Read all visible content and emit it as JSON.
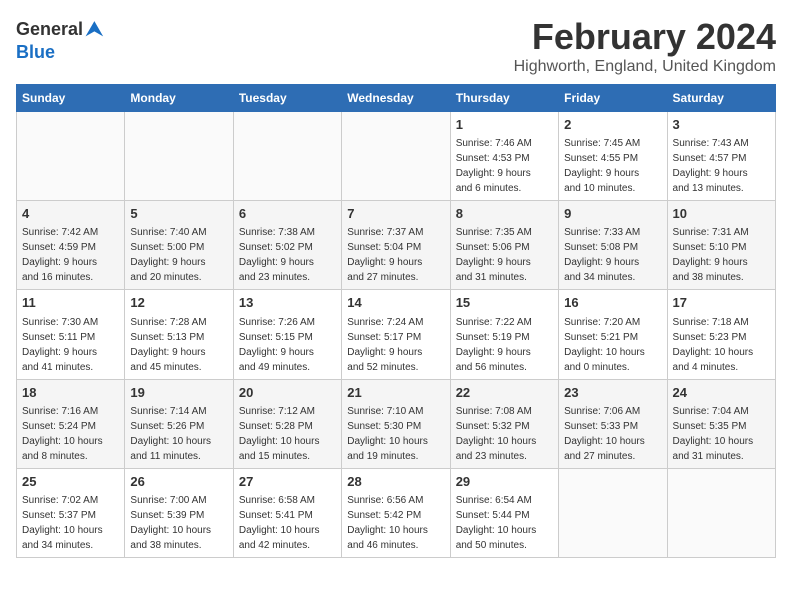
{
  "header": {
    "logo_general": "General",
    "logo_blue": "Blue",
    "title": "February 2024",
    "subtitle": "Highworth, England, United Kingdom"
  },
  "calendar": {
    "columns": [
      "Sunday",
      "Monday",
      "Tuesday",
      "Wednesday",
      "Thursday",
      "Friday",
      "Saturday"
    ],
    "weeks": [
      [
        {
          "day": "",
          "info": ""
        },
        {
          "day": "",
          "info": ""
        },
        {
          "day": "",
          "info": ""
        },
        {
          "day": "",
          "info": ""
        },
        {
          "day": "1",
          "info": "Sunrise: 7:46 AM\nSunset: 4:53 PM\nDaylight: 9 hours\nand 6 minutes."
        },
        {
          "day": "2",
          "info": "Sunrise: 7:45 AM\nSunset: 4:55 PM\nDaylight: 9 hours\nand 10 minutes."
        },
        {
          "day": "3",
          "info": "Sunrise: 7:43 AM\nSunset: 4:57 PM\nDaylight: 9 hours\nand 13 minutes."
        }
      ],
      [
        {
          "day": "4",
          "info": "Sunrise: 7:42 AM\nSunset: 4:59 PM\nDaylight: 9 hours\nand 16 minutes."
        },
        {
          "day": "5",
          "info": "Sunrise: 7:40 AM\nSunset: 5:00 PM\nDaylight: 9 hours\nand 20 minutes."
        },
        {
          "day": "6",
          "info": "Sunrise: 7:38 AM\nSunset: 5:02 PM\nDaylight: 9 hours\nand 23 minutes."
        },
        {
          "day": "7",
          "info": "Sunrise: 7:37 AM\nSunset: 5:04 PM\nDaylight: 9 hours\nand 27 minutes."
        },
        {
          "day": "8",
          "info": "Sunrise: 7:35 AM\nSunset: 5:06 PM\nDaylight: 9 hours\nand 31 minutes."
        },
        {
          "day": "9",
          "info": "Sunrise: 7:33 AM\nSunset: 5:08 PM\nDaylight: 9 hours\nand 34 minutes."
        },
        {
          "day": "10",
          "info": "Sunrise: 7:31 AM\nSunset: 5:10 PM\nDaylight: 9 hours\nand 38 minutes."
        }
      ],
      [
        {
          "day": "11",
          "info": "Sunrise: 7:30 AM\nSunset: 5:11 PM\nDaylight: 9 hours\nand 41 minutes."
        },
        {
          "day": "12",
          "info": "Sunrise: 7:28 AM\nSunset: 5:13 PM\nDaylight: 9 hours\nand 45 minutes."
        },
        {
          "day": "13",
          "info": "Sunrise: 7:26 AM\nSunset: 5:15 PM\nDaylight: 9 hours\nand 49 minutes."
        },
        {
          "day": "14",
          "info": "Sunrise: 7:24 AM\nSunset: 5:17 PM\nDaylight: 9 hours\nand 52 minutes."
        },
        {
          "day": "15",
          "info": "Sunrise: 7:22 AM\nSunset: 5:19 PM\nDaylight: 9 hours\nand 56 minutes."
        },
        {
          "day": "16",
          "info": "Sunrise: 7:20 AM\nSunset: 5:21 PM\nDaylight: 10 hours\nand 0 minutes."
        },
        {
          "day": "17",
          "info": "Sunrise: 7:18 AM\nSunset: 5:23 PM\nDaylight: 10 hours\nand 4 minutes."
        }
      ],
      [
        {
          "day": "18",
          "info": "Sunrise: 7:16 AM\nSunset: 5:24 PM\nDaylight: 10 hours\nand 8 minutes."
        },
        {
          "day": "19",
          "info": "Sunrise: 7:14 AM\nSunset: 5:26 PM\nDaylight: 10 hours\nand 11 minutes."
        },
        {
          "day": "20",
          "info": "Sunrise: 7:12 AM\nSunset: 5:28 PM\nDaylight: 10 hours\nand 15 minutes."
        },
        {
          "day": "21",
          "info": "Sunrise: 7:10 AM\nSunset: 5:30 PM\nDaylight: 10 hours\nand 19 minutes."
        },
        {
          "day": "22",
          "info": "Sunrise: 7:08 AM\nSunset: 5:32 PM\nDaylight: 10 hours\nand 23 minutes."
        },
        {
          "day": "23",
          "info": "Sunrise: 7:06 AM\nSunset: 5:33 PM\nDaylight: 10 hours\nand 27 minutes."
        },
        {
          "day": "24",
          "info": "Sunrise: 7:04 AM\nSunset: 5:35 PM\nDaylight: 10 hours\nand 31 minutes."
        }
      ],
      [
        {
          "day": "25",
          "info": "Sunrise: 7:02 AM\nSunset: 5:37 PM\nDaylight: 10 hours\nand 34 minutes."
        },
        {
          "day": "26",
          "info": "Sunrise: 7:00 AM\nSunset: 5:39 PM\nDaylight: 10 hours\nand 38 minutes."
        },
        {
          "day": "27",
          "info": "Sunrise: 6:58 AM\nSunset: 5:41 PM\nDaylight: 10 hours\nand 42 minutes."
        },
        {
          "day": "28",
          "info": "Sunrise: 6:56 AM\nSunset: 5:42 PM\nDaylight: 10 hours\nand 46 minutes."
        },
        {
          "day": "29",
          "info": "Sunrise: 6:54 AM\nSunset: 5:44 PM\nDaylight: 10 hours\nand 50 minutes."
        },
        {
          "day": "",
          "info": ""
        },
        {
          "day": "",
          "info": ""
        }
      ]
    ]
  }
}
